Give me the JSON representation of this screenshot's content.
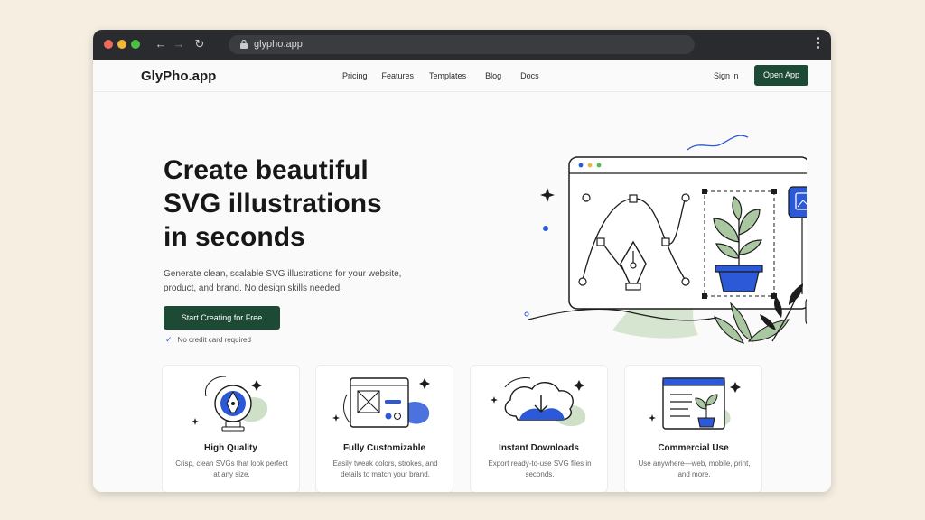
{
  "browser": {
    "url": "glypho.app"
  },
  "nav": {
    "logo": "GlyPho.app",
    "links": [
      "Pricing",
      "Features",
      "Templates",
      "Blog",
      "Docs"
    ],
    "sign_in": "Sign in",
    "open_app": "Open App"
  },
  "hero": {
    "title_lines": [
      "Create beautiful",
      "SVG illustrations",
      "in seconds"
    ],
    "subtitle": "Generate clean, scalable SVG illustrations for your website, product, and brand. No design skills needed.",
    "cta": "Start Creating for Free",
    "note": "No credit card required"
  },
  "features": [
    {
      "title": "High Quality",
      "desc": "Crisp, clean SVGs that look perfect at any size.",
      "icon": "pen-nib-icon"
    },
    {
      "title": "Fully Customizable",
      "desc": "Easily tweak colors, strokes, and details to match your brand.",
      "icon": "editor-window-icon"
    },
    {
      "title": "Instant Downloads",
      "desc": "Export ready-to-use SVG files in seconds.",
      "icon": "cloud-download-icon"
    },
    {
      "title": "Commercial Use",
      "desc": "Use anywhere—web, mobile, print, and more.",
      "icon": "document-plant-icon"
    }
  ],
  "colors": {
    "brand_green": "#1d4a34",
    "accent_blue": "#2c59d8",
    "sage": "#cfe0c8",
    "star_yellow": "#f1b63a"
  }
}
